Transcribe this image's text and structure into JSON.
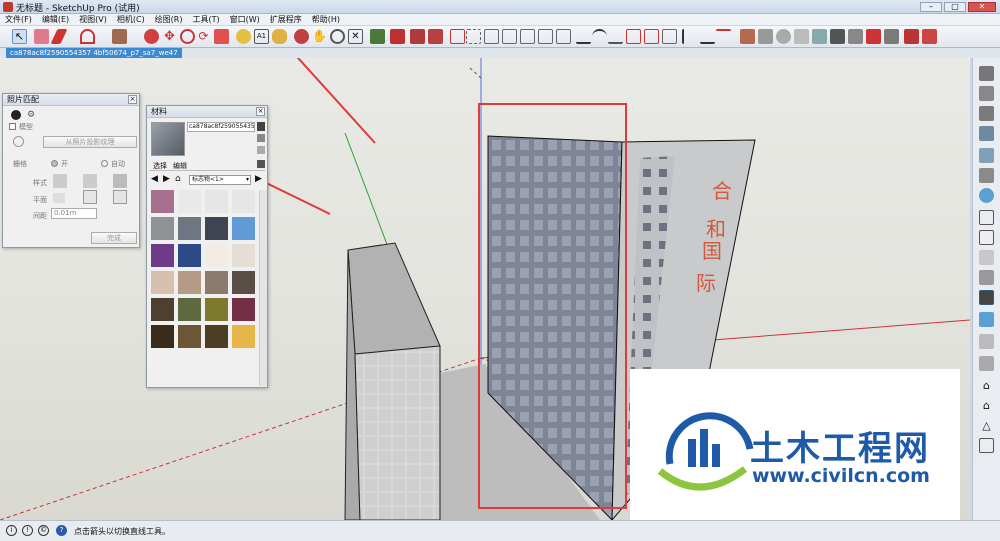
{
  "window": {
    "title": "无标题 - SketchUp Pro (试用)"
  },
  "menu": [
    "文件(F)",
    "编辑(E)",
    "视图(V)",
    "相机(C)",
    "绘图(R)",
    "工具(T)",
    "窗口(W)",
    "扩展程序",
    "帮助(H)"
  ],
  "scene_tab": "ca878ac8f2590554357 4bf50674_p7_sa7_we47",
  "photo_match": {
    "title": "照片匹配",
    "model_label": "模型",
    "project_button": "从照片投影纹理",
    "grid_label": "栅格",
    "on_label": "开",
    "auto_label": "自动",
    "style_label": "样式",
    "plane_label": "平面",
    "spacing_label": "间距",
    "spacing_value": "0.01m",
    "done_button": "完成"
  },
  "materials": {
    "title": "材料",
    "name_value": "ca878ac8f2590554357",
    "tab_select": "选择",
    "tab_edit": "编辑",
    "dropdown_value": "标志物<1>",
    "swatch_colors": [
      [
        "#a86f90",
        "#e9e9e9",
        "#e6e6e6",
        "#e6e6e6"
      ],
      [
        "#8d9297",
        "#6e7583",
        "#3e4452",
        "#6198d6"
      ],
      [
        "#6d3b87",
        "#2d4a86",
        "#f3ece5",
        "#e6ddd5"
      ],
      [
        "#d7c0ad",
        "#b59a84",
        "#8c7b6c",
        "#594f45"
      ],
      [
        "#4e4030",
        "#5e6a3e",
        "#7d7a2e",
        "#722f45"
      ],
      [
        "#3a2b1c",
        "#6b5735",
        "#4c3d25",
        "#e6b64b"
      ]
    ]
  },
  "building_sign": [
    "合",
    "和",
    "国",
    "际"
  ],
  "status": {
    "text": "点击箭头以切换直线工具。"
  },
  "watermark": {
    "brand": "土木工程网",
    "url": "www.civilcn.com"
  },
  "colors": {
    "accent": "#3d8ad1",
    "annotation_red": "#e03a3a",
    "sign_red": "#d4583a"
  }
}
